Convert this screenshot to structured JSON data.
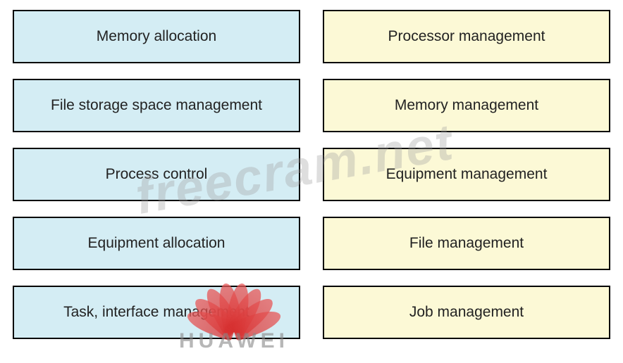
{
  "left_column": [
    "Memory allocation",
    "File storage space management",
    "Process control",
    "Equipment allocation",
    "Task, interface management"
  ],
  "right_column": [
    "Processor management",
    "Memory management",
    "Equipment management",
    "File management",
    "Job management"
  ],
  "watermark": "freecram.net",
  "logo_text": "HUAWEI"
}
